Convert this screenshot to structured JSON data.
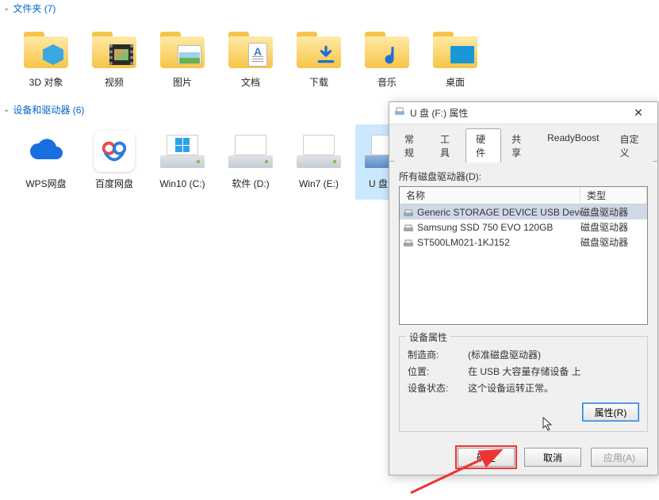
{
  "groups": {
    "folders": {
      "title": "文件夹 (7)"
    },
    "drives": {
      "title": "设备和驱动器 (6)"
    }
  },
  "folders": [
    {
      "name": "3D 对象",
      "kind": "cube"
    },
    {
      "name": "视频",
      "kind": "film"
    },
    {
      "name": "图片",
      "kind": "photo"
    },
    {
      "name": "文档",
      "kind": "doc"
    },
    {
      "name": "下载",
      "kind": "download"
    },
    {
      "name": "音乐",
      "kind": "music"
    },
    {
      "name": "桌面",
      "kind": "desktop"
    }
  ],
  "drives": [
    {
      "name": "WPS网盘",
      "kind": "wps"
    },
    {
      "name": "百度网盘",
      "kind": "baidu"
    },
    {
      "name": "Win10 (C:)",
      "kind": "drive-win"
    },
    {
      "name": "软件 (D:)",
      "kind": "drive"
    },
    {
      "name": "Win7 (E:)",
      "kind": "drive"
    },
    {
      "name": "U 盘 (F:)",
      "kind": "usb",
      "selected": true
    }
  ],
  "dialog": {
    "title": "U 盘 (F:) 属性",
    "tabs": [
      "常规",
      "工具",
      "硬件",
      "共享",
      "ReadyBoost",
      "自定义"
    ],
    "activeTab": 2,
    "disks_label": "所有磁盘驱动器(D):",
    "cols": {
      "name": "名称",
      "type": "类型"
    },
    "rows": [
      {
        "name": "Generic STORAGE DEVICE USB Device",
        "type": "磁盘驱动器",
        "selected": true
      },
      {
        "name": "Samsung SSD 750 EVO 120GB",
        "type": "磁盘驱动器"
      },
      {
        "name": "ST500LM021-1KJ152",
        "type": "磁盘驱动器"
      }
    ],
    "props_title": "设备属性",
    "manufacturer_k": "制造商:",
    "manufacturer_v": "(标准磁盘驱动器)",
    "location_k": "位置:",
    "location_v": "在 USB 大容量存储设备 上",
    "status_k": "设备状态:",
    "status_v": "这个设备运转正常。",
    "props_btn": "属性(R)",
    "ok": "确定",
    "cancel": "取消",
    "apply": "应用(A)"
  }
}
